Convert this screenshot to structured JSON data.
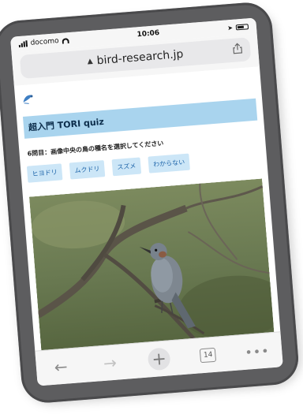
{
  "status": {
    "carrier": "docomo",
    "time": "10:06"
  },
  "browser": {
    "url": "bird-research.jp",
    "tab_count": "14"
  },
  "page": {
    "title": "超入門 TORI quiz",
    "question": "6問目：画像中央の鳥の種名を選択してください",
    "answers": [
      "ヒヨドリ",
      "ムクドリ",
      "スズメ",
      "わからない"
    ]
  },
  "icons": {
    "share": "share-icon",
    "back": "back-arrow-icon",
    "forward": "forward-arrow-icon",
    "add": "plus-icon",
    "more": "more-dots-icon"
  },
  "colors": {
    "title_bar": "#a9d4ee",
    "answer_button": "#cce6f7",
    "phone_body": "#5d5d5f"
  }
}
